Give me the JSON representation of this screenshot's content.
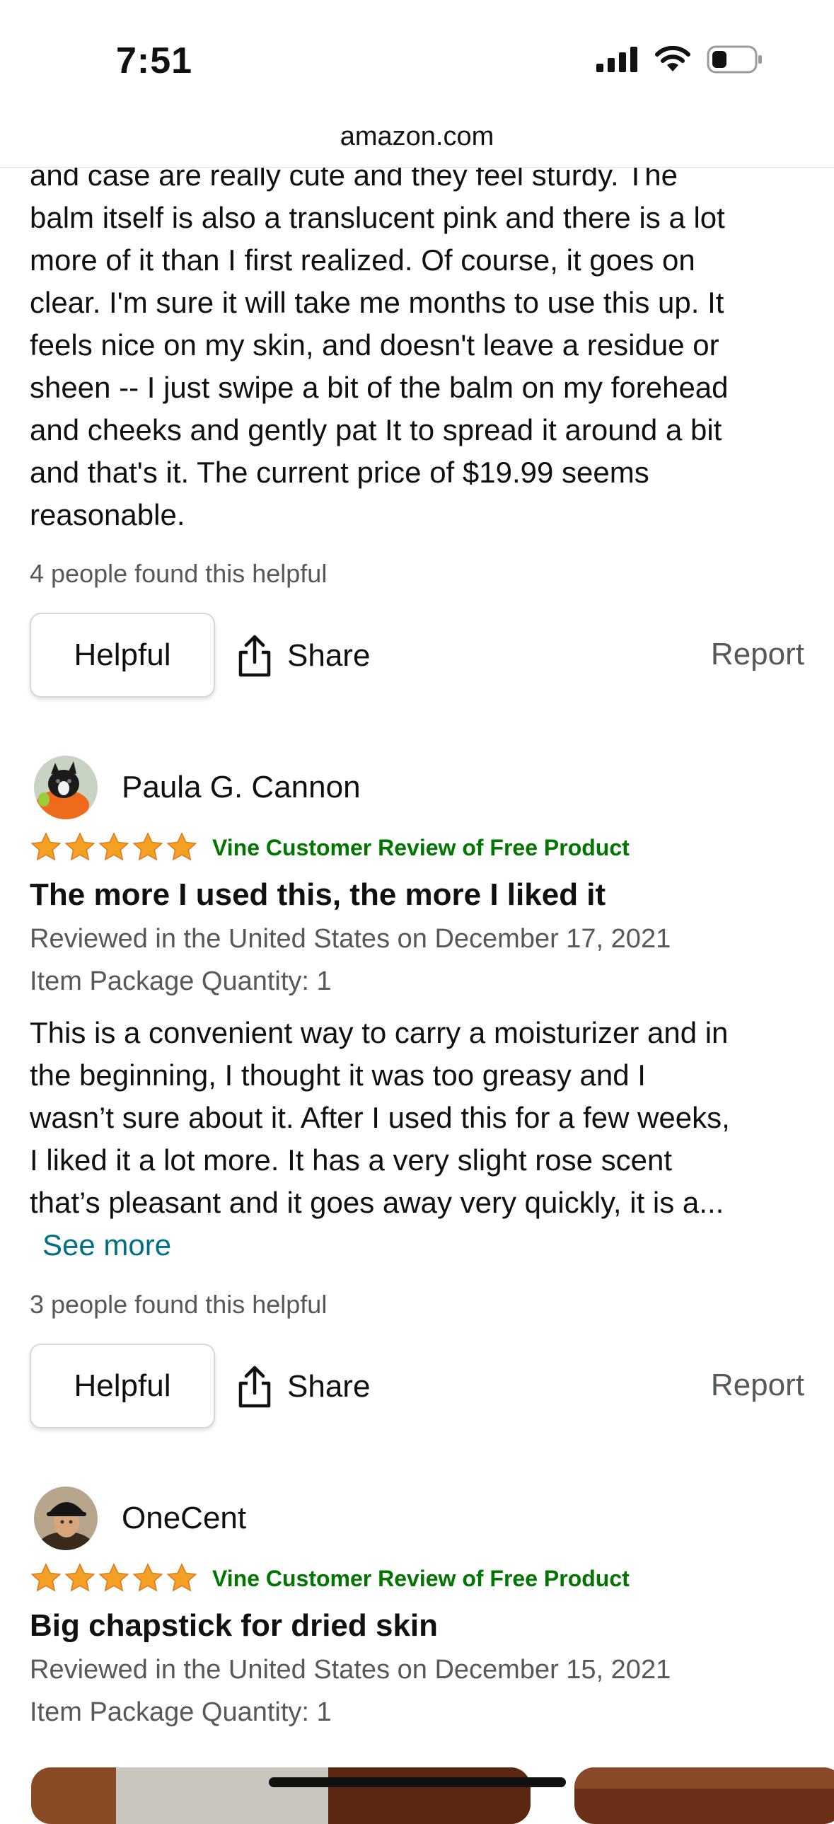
{
  "status_bar": {
    "time": "7:51"
  },
  "browser": {
    "url": "amazon.com"
  },
  "review_prev": {
    "lines": [
      "and case are really cute and they feel sturdy. The",
      "balm itself is also a translucent pink and there is a lot",
      "more of it than I first realized. Of course, it goes on",
      "clear. I'm sure it will take me months to use this up. It",
      "feels nice on my skin, and doesn't leave a residue or",
      "sheen -- I just swipe a bit of the balm on my forehead",
      "and cheeks and gently pat It to spread it around a bit",
      "and that's it. The current price of $19.99 seems",
      "reasonable."
    ],
    "helpful_count": "4 people found this helpful",
    "helpful_label": "Helpful",
    "share_label": "Share",
    "report_label": "Report"
  },
  "review_1": {
    "reviewer": "Paula G. Cannon",
    "rating": 5,
    "vine_label": "Vine Customer Review of Free Product",
    "title": "The more I used this, the more I liked it",
    "date": "Reviewed in the United States on December 17, 2021",
    "quantity": "Item Package Quantity: 1",
    "lines": [
      "This is a convenient way to carry a moisturizer and in",
      "the beginning, I thought it was too greasy and I",
      "wasn’t sure about it. After I used this for a few weeks,",
      "I liked it a lot more. It has a very slight rose scent",
      "that’s pleasant and it goes away very quickly, it is a..."
    ],
    "see_more": "See more",
    "helpful_count": "3 people found this helpful",
    "helpful_label": "Helpful",
    "share_label": "Share",
    "report_label": "Report"
  },
  "review_2": {
    "reviewer": "OneCent",
    "rating": 5,
    "vine_label": "Vine Customer Review of Free Product",
    "title": "Big chapstick for dried skin",
    "date": "Reviewed in the United States on December 15, 2021",
    "quantity": "Item Package Quantity: 1"
  },
  "colors": {
    "star": "#f4a024",
    "vine_green": "#007600",
    "link_teal": "#007185",
    "muted_text": "#565959"
  },
  "icons": [
    "cellular-signal-icon",
    "wifi-icon",
    "battery-icon",
    "share-icon",
    "star-icon",
    "avatar-image"
  ]
}
